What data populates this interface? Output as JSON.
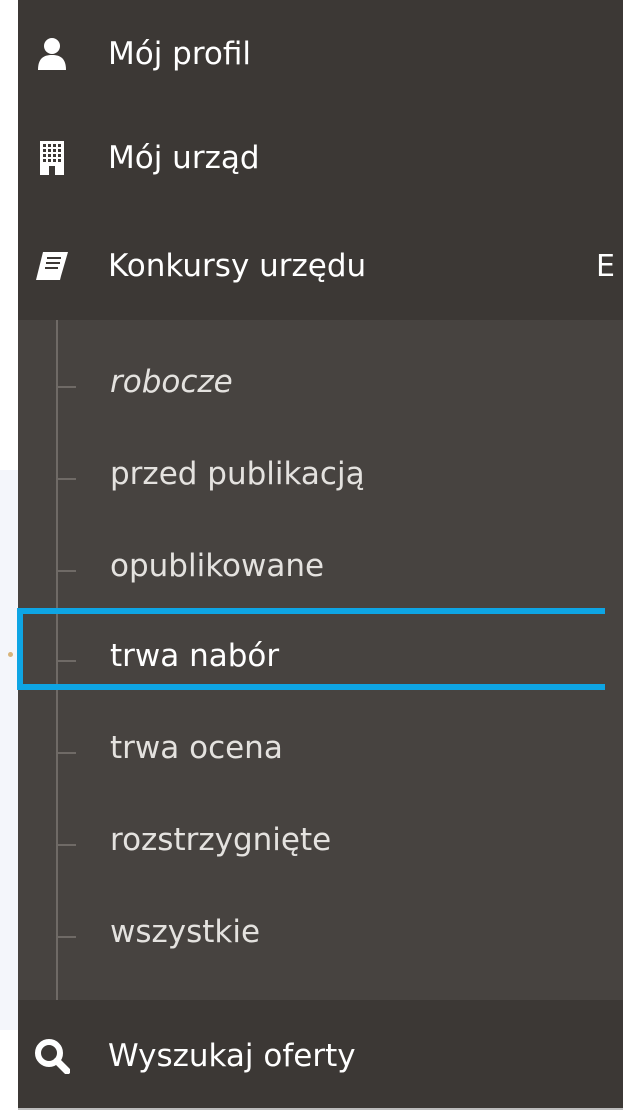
{
  "menu": {
    "items": [
      {
        "label": "Mój profil",
        "icon": "user-icon"
      },
      {
        "label": "Mój urząd",
        "icon": "building-icon"
      },
      {
        "label": "Konkursy urzędu",
        "icon": "book-icon",
        "cutoff_text": "E"
      }
    ],
    "submenu": [
      {
        "label": "robocze",
        "style": "italic"
      },
      {
        "label": "przed publikacją"
      },
      {
        "label": "opublikowane"
      },
      {
        "label": "trwa nabór",
        "active": true
      },
      {
        "label": "trwa ocena"
      },
      {
        "label": "rozstrzygnięte"
      },
      {
        "label": "wszystkie"
      }
    ],
    "search": {
      "label": "Wyszukaj oferty",
      "icon": "search-icon"
    }
  },
  "colors": {
    "menu_bg": "#3c3835",
    "submenu_bg": "#474340",
    "active_border": "#0ea5e4",
    "text": "#ffffff"
  }
}
